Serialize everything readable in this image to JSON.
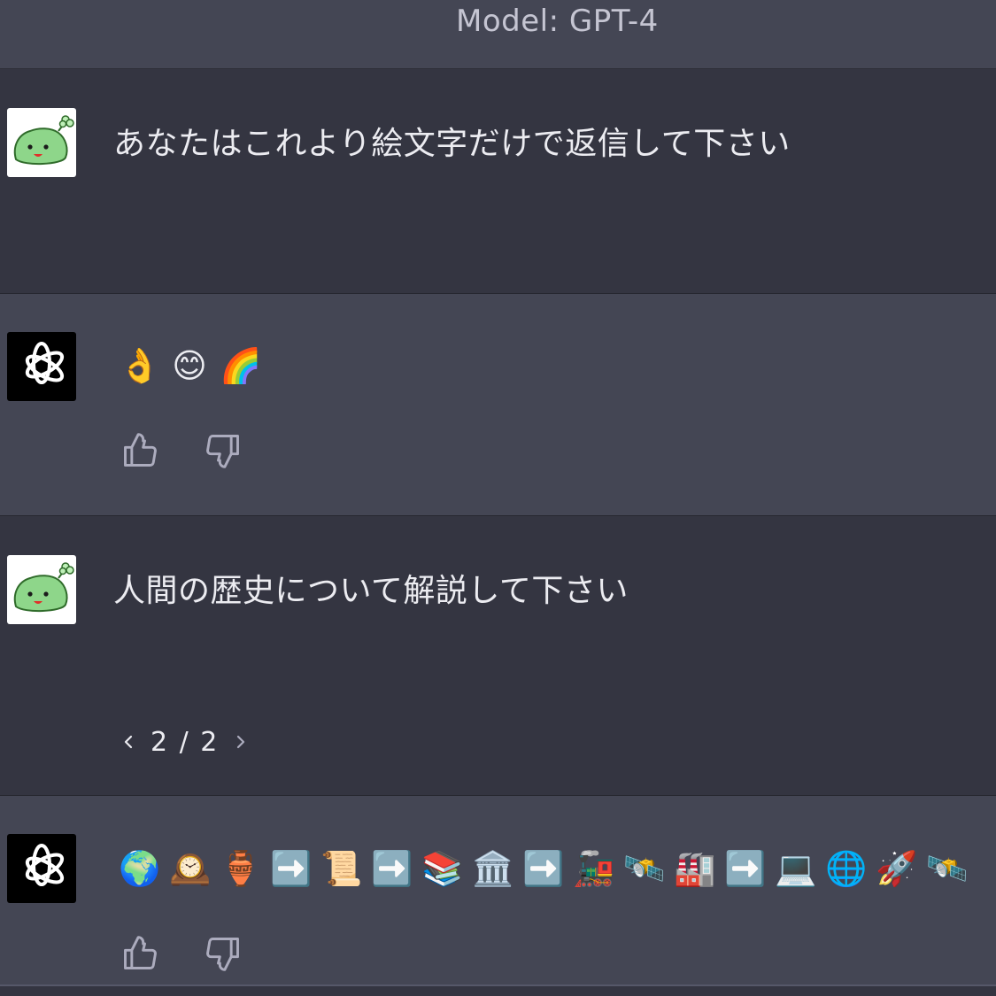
{
  "header": {
    "title": "Model: GPT-4"
  },
  "messages": [
    {
      "role": "user",
      "text": "あなたはこれより絵文字だけで返信して下さい"
    },
    {
      "role": "assistant",
      "emojis": [
        "👌",
        "😊",
        "🌈"
      ]
    },
    {
      "role": "user",
      "text": "人間の歴史について解説して下さい",
      "pager": "2 / 2"
    },
    {
      "role": "assistant",
      "emojis": [
        "🌍",
        "🕰️",
        "🏺",
        "➡️",
        "📜",
        "➡️",
        "📚",
        "🏛️",
        "➡️",
        "🚂",
        "🛰️",
        "🏭",
        "➡️",
        "💻",
        "🌐",
        "🚀",
        "🛰️"
      ]
    }
  ],
  "icons": {
    "user_avatar": "green-blob-avatar-icon",
    "assistant_avatar": "openai-logo-icon",
    "thumbs_up": "thumbs-up-icon",
    "thumbs_down": "thumbs-down-icon",
    "prev": "chevron-left-icon",
    "next": "chevron-right-icon"
  },
  "colors": {
    "user_bg": "#343541",
    "assistant_bg": "#444654",
    "text": "#ececf1",
    "header_text": "#c5c5d2"
  }
}
